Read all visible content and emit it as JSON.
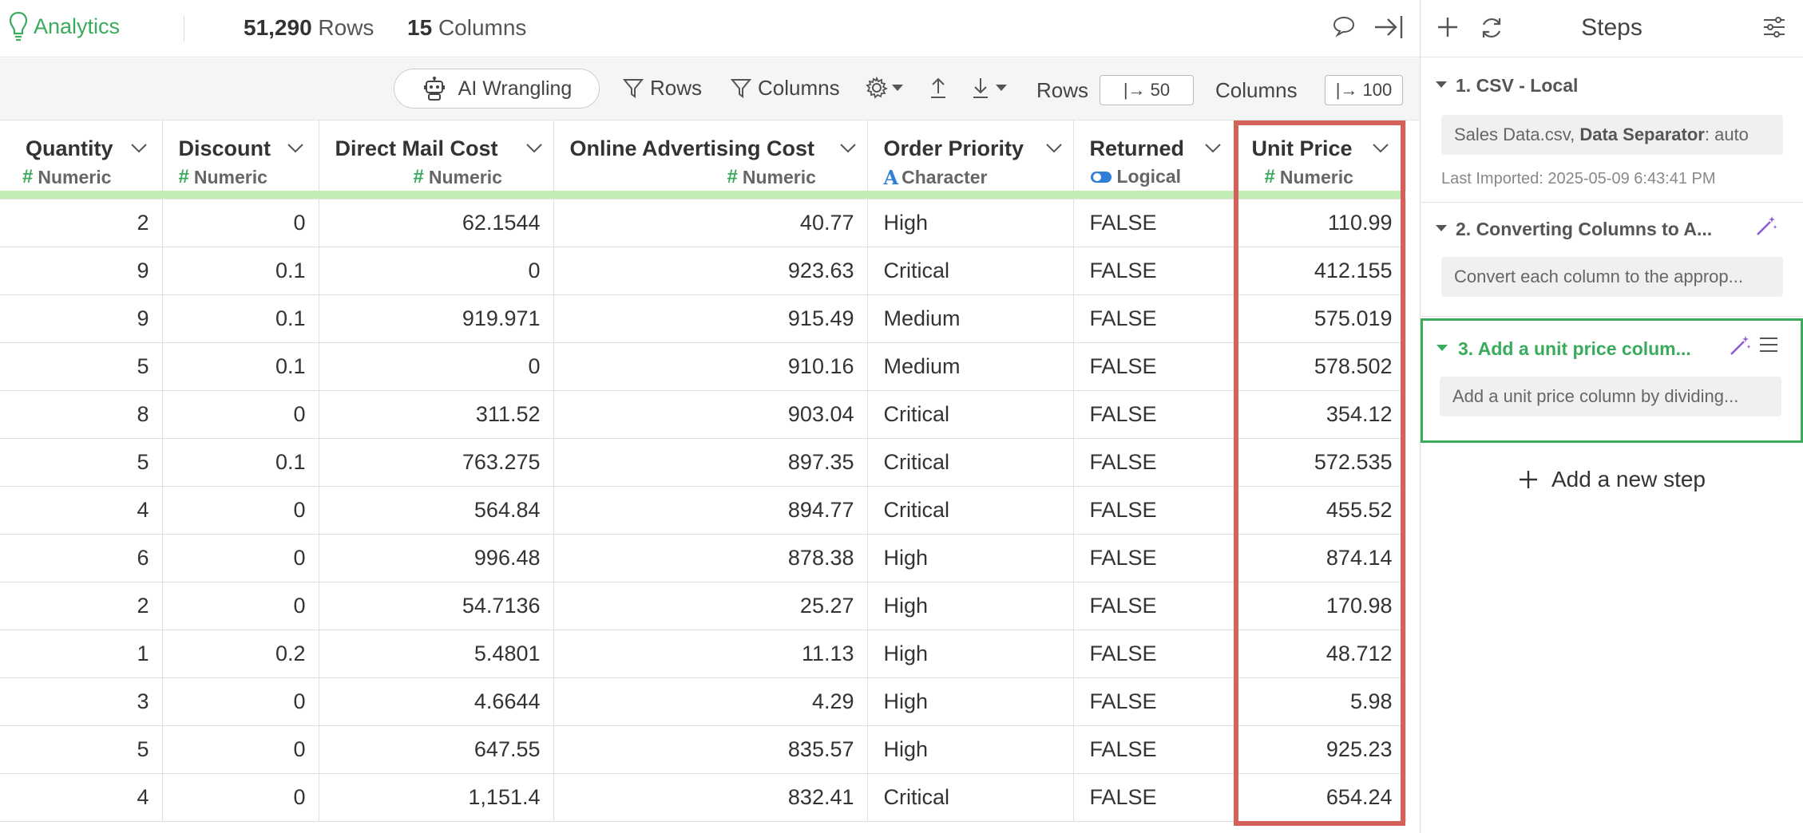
{
  "topbar": {
    "app_tab": "Analytics",
    "row_count": "51,290",
    "rows_label": "Rows",
    "col_count": "15",
    "cols_label": "Columns"
  },
  "toolbar": {
    "ai_label": "AI Wrangling",
    "filter_rows_label": "Rows",
    "filter_cols_label": "Columns",
    "rows_label": "Rows",
    "rows_value": "|→ 50",
    "columns_label": "Columns",
    "columns_value": "|→ 100"
  },
  "table": {
    "columns": [
      {
        "name": "Quantity",
        "type": "Numeric"
      },
      {
        "name": "Discount",
        "type": "Numeric"
      },
      {
        "name": "Direct Mail Cost",
        "type": "Numeric"
      },
      {
        "name": "Online Advertising Cost",
        "type": "Numeric"
      },
      {
        "name": "Order Priority",
        "type": "Character"
      },
      {
        "name": "Returned",
        "type": "Logical"
      },
      {
        "name": "Unit Price",
        "type": "Numeric"
      }
    ],
    "rows": [
      [
        "2",
        "0",
        "62.1544",
        "40.77",
        "High",
        "FALSE",
        "110.99"
      ],
      [
        "9",
        "0.1",
        "0",
        "923.63",
        "Critical",
        "FALSE",
        "412.155"
      ],
      [
        "9",
        "0.1",
        "919.971",
        "915.49",
        "Medium",
        "FALSE",
        "575.019"
      ],
      [
        "5",
        "0.1",
        "0",
        "910.16",
        "Medium",
        "FALSE",
        "578.502"
      ],
      [
        "8",
        "0",
        "311.52",
        "903.04",
        "Critical",
        "FALSE",
        "354.12"
      ],
      [
        "5",
        "0.1",
        "763.275",
        "897.35",
        "Critical",
        "FALSE",
        "572.535"
      ],
      [
        "4",
        "0",
        "564.84",
        "894.77",
        "Critical",
        "FALSE",
        "455.52"
      ],
      [
        "6",
        "0",
        "996.48",
        "878.38",
        "High",
        "FALSE",
        "874.14"
      ],
      [
        "2",
        "0",
        "54.7136",
        "25.27",
        "High",
        "FALSE",
        "170.98"
      ],
      [
        "1",
        "0.2",
        "5.4801",
        "11.13",
        "High",
        "FALSE",
        "48.712"
      ],
      [
        "3",
        "0",
        "4.6644",
        "4.29",
        "High",
        "FALSE",
        "5.98"
      ],
      [
        "5",
        "0",
        "647.55",
        "835.57",
        "High",
        "FALSE",
        "925.23"
      ],
      [
        "4",
        "0",
        "1,151.4",
        "832.41",
        "Critical",
        "FALSE",
        "654.24"
      ]
    ]
  },
  "steps_panel": {
    "title": "Steps",
    "steps": [
      {
        "title": "1. CSV - Local",
        "detail_file": "Sales Data.csv,",
        "detail_key": "Data Separator",
        "detail_value": ": auto",
        "meta": "Last Imported: 2025-05-09 6:43:41 PM"
      },
      {
        "title": "2. Converting Columns to A...",
        "detail": "Convert each column to the approp..."
      },
      {
        "title": "3. Add a unit price colum...",
        "detail": "Add a unit price column by dividing..."
      }
    ],
    "add_step_label": "Add a new step"
  },
  "colors": {
    "accent_green": "#3aaa5c",
    "highlight_red": "#d4625a",
    "ai_purple": "#8e5bd6",
    "header_band": "#c2eeb5"
  }
}
